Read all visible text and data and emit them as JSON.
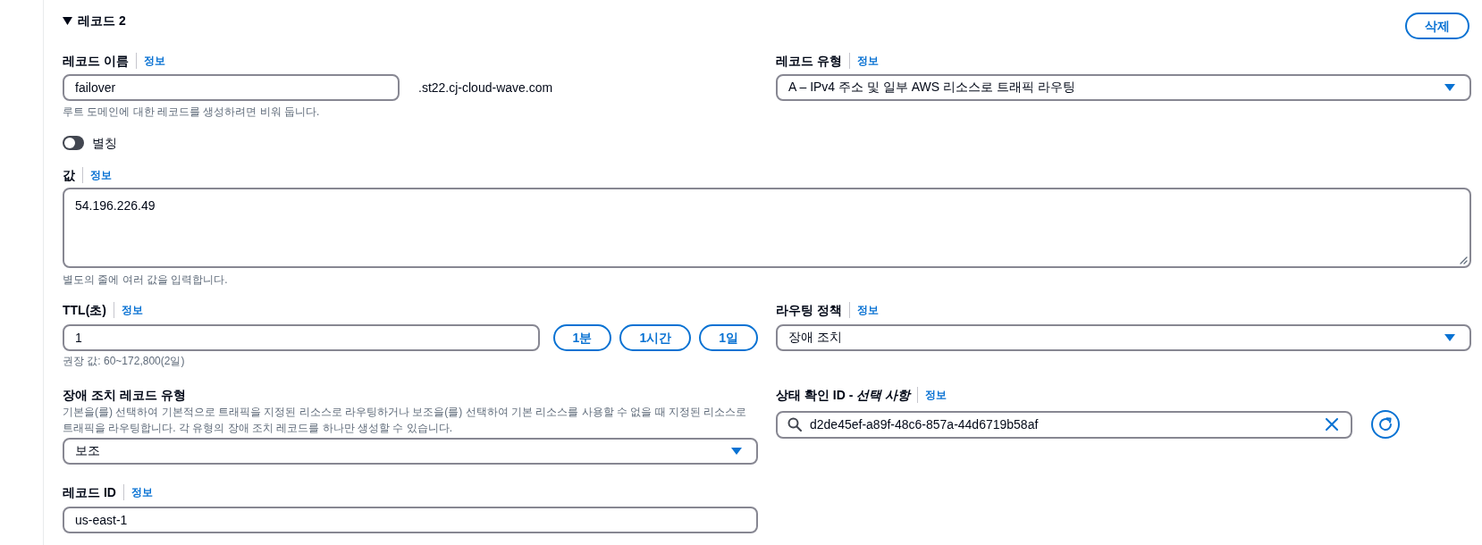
{
  "record": {
    "title": "레코드 2",
    "expanded": true,
    "delete_label": "삭제"
  },
  "record_name": {
    "label": "레코드 이름",
    "info": "정보",
    "value": "failover",
    "suffix": ".st22.cj-cloud-wave.com",
    "hint": "루트 도메인에 대한 레코드를 생성하려면 비워 둡니다."
  },
  "record_type": {
    "label": "레코드 유형",
    "info": "정보",
    "value": "A – IPv4 주소 및 일부 AWS 리소스로 트래픽 라우팅"
  },
  "alias": {
    "label": "별칭",
    "on": false
  },
  "value": {
    "label": "값",
    "info": "정보",
    "value": "54.196.226.49",
    "hint": "별도의 줄에 여러 값을 입력합니다."
  },
  "ttl": {
    "label": "TTL(초)",
    "info": "정보",
    "value": "1",
    "presets": [
      "1분",
      "1시간",
      "1일"
    ],
    "hint": "권장 값: 60~172,800(2일)"
  },
  "routing_policy": {
    "label": "라우팅 정책",
    "info": "정보",
    "value": "장애 조치"
  },
  "failover_type": {
    "label": "장애 조치 레코드 유형",
    "description": "기본을(를) 선택하여 기본적으로 트래픽을 지정된 리소스로 라우팅하거나 보조을(를) 선택하여 기본 리소스를 사용할 수 없을 때 지정된 리소스로 트래픽을 라우팅합니다. 각 유형의 장애 조치 레코드를 하나만 생성할 수 있습니다.",
    "value": "보조"
  },
  "health_check": {
    "label": "상태 확인 ID - *선택 사항*",
    "info": "정보",
    "value": "d2de45ef-a89f-48c6-857a-44d6719b58af"
  },
  "record_id": {
    "label": "레코드 ID",
    "info": "정보",
    "value": "us-east-1"
  }
}
